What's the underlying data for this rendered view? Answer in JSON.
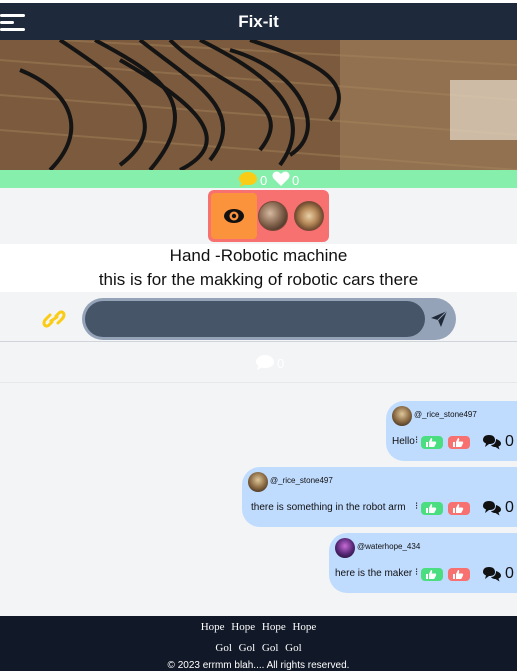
{
  "header": {
    "title": "Fix-it",
    "menu_icon": "hamburger-menu-icon"
  },
  "post": {
    "image_alt": "cables on wooden table",
    "comments_count": "0",
    "likes_count": "0",
    "title": "Hand -Robotic machine",
    "description": "this is for the makking of robotic cars there"
  },
  "comment_input": {
    "value": "",
    "placeholder": ""
  },
  "comments_total": "0",
  "comments": [
    {
      "username": "@_rice_stone497",
      "text": "Hello",
      "replies": "0"
    },
    {
      "username": "@_rice_stone497",
      "text": "there is something in the robot arm",
      "replies": "0"
    },
    {
      "username": "@waterhope_434",
      "text": "here is the maker",
      "replies": "0"
    }
  ],
  "footer": {
    "row1": [
      "Hope",
      "Hope",
      "Hope",
      "Hope"
    ],
    "row2": [
      "Gol",
      "Gol",
      "Gol",
      "Gol"
    ],
    "copyright": "© 2023 errmm blah.... All rights reserved."
  },
  "colors": {
    "topbar": "#1e293b",
    "stats_bar": "#86efac",
    "action_box": "#f87171",
    "eye_button": "#fb923c",
    "bubble": "#bfdbfe",
    "upvote": "#4ade80",
    "downvote": "#f87171",
    "footer": "#111827"
  }
}
